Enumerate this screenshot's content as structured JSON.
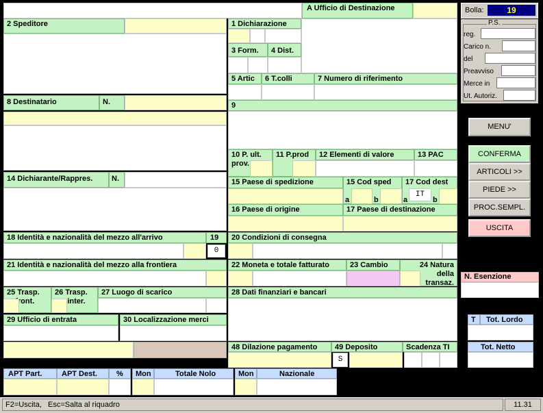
{
  "title": "A Ufficio di Destinazione",
  "labels": {
    "speditore": "2 Speditore",
    "dichiarazione": "1 Dichiarazione",
    "form": "3 Form.",
    "dist": "4 Dist.",
    "artic": "5 Artic",
    "tcolli": "6 T.colli",
    "numrif": "7 Numero di riferimento",
    "destinatario": "8 Destinatario",
    "destinatario_n": "N.",
    "b9": "9",
    "pult": "10 P. ult.",
    "prov": "prov.",
    "pprod": "11 P.prod",
    "elementi": "12 Elementi di valore",
    "pac": "13 PAC",
    "dichiarante": "14 Dichiarante/Rappres.",
    "dichiarante_n": "N.",
    "paese_sped": "15 Paese di spedizione",
    "cod_sped": "15 Cod sped",
    "cod_dest": "17 Cod dest",
    "a": "a",
    "b": "b",
    "paese_orig": "16 Paese di origine",
    "paese_dest": "17 Paese di destinazione",
    "identita_arrivo": "18 Identità e nazionalità del mezzo all'arrivo",
    "b19": "19",
    "condizioni": "20 Condizioni di consegna",
    "identita_frontiera": "21 Identità e nazionalità del mezzo alla frontiera",
    "moneta": "22 Moneta e totale fatturato",
    "cambio": "23 Cambio",
    "natura1": "24  Natura",
    "natura2": "della",
    "natura3": "transaz.",
    "trasp_front1": "25 Trasp.",
    "trasp_front2": "front.",
    "trasp_inter1": "26 Trasp.",
    "trasp_inter2": "inter.",
    "luogo": "27 Luogo di scarico",
    "dati_fin": "28 Dati finanziari e bancari",
    "ufficio_entrata": "29 Ufficio di entrata",
    "localizzazione": "30 Localizzazione merci",
    "dilazione": "48 Dilazione pagamento",
    "deposito": "49 Deposito",
    "scadenza": "Scadenza TI",
    "apt_part": "APT Part.",
    "apt_dest": "APT Dest.",
    "perc": "%",
    "mon1": "Mon",
    "totale_nolo": "Totale Nolo",
    "mon2": "Mon",
    "nazionale": "Nazionale",
    "esenzione": "N. Esenzione",
    "t": "T",
    "tot_lordo": "Tot. Lordo",
    "tot_netto": "Tot. Netto"
  },
  "values": {
    "b19": "0",
    "cod_dest_a": "IT",
    "deposito_code": "S"
  },
  "bolla": {
    "label": "Bolla:",
    "value": "19"
  },
  "ps": {
    "title": "P.S.",
    "reg": "reg.",
    "carico": "Carico n.",
    "del": "del",
    "preavviso": "Preavviso",
    "merce": "Merce in",
    "ut": "Ut. Autoriz."
  },
  "buttons": {
    "menu": "MENU'",
    "conferma": "CONFERMA",
    "articoli": "ARTICOLI >>",
    "piede": "PIEDE >>",
    "proc": "PROC.SEMPL.",
    "uscita": "USCITA"
  },
  "colors": {
    "green": "#c3f3c3",
    "yellow": "#fdfdc6",
    "pink": "#ffc9c9",
    "blue": "#c6dcff",
    "magenta": "#f3c9f0"
  },
  "status": {
    "help": "F2=Uscita,   Esc=Salta al riquadro",
    "time": "11.31"
  }
}
